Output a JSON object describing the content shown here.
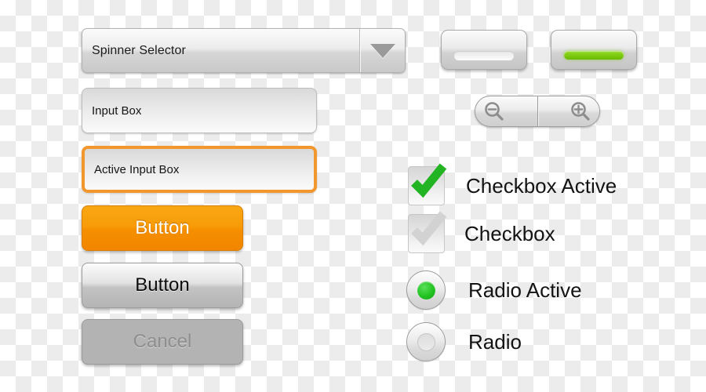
{
  "theme": {
    "accent_orange": "#f58f00",
    "accent_green": "#7ecc12",
    "radio_green": "#22c322",
    "check_green": "#22b422",
    "focus_border": "#f2972e",
    "text_dark": "#131313",
    "text_disabled": "#8e8e8e",
    "canvas_checker_light": "#ffffff",
    "canvas_checker_dark": "#ececec"
  },
  "spinner": {
    "label": "Spinner Selector",
    "arrow_icon": "chevron-down-icon"
  },
  "inputs": [
    {
      "value": "Input Box",
      "state": "normal"
    },
    {
      "value": "Active Input Box",
      "state": "active"
    }
  ],
  "buttons": [
    {
      "label": "Button",
      "style": "primary-orange"
    },
    {
      "label": "Button",
      "style": "default-grey"
    },
    {
      "label": "Cancel",
      "style": "disabled"
    }
  ],
  "toggles": [
    {
      "state": "off",
      "bar_color": "#f2f2f2"
    },
    {
      "state": "on",
      "bar_color": "#7ecc12"
    }
  ],
  "zoom_control": {
    "zoom_out_icon": "magnifier-minus-icon",
    "zoom_in_icon": "magnifier-plus-icon"
  },
  "checkboxes": [
    {
      "label": "Checkbox Active",
      "checked": true,
      "check_icon": "checkmark-icon",
      "check_color": "#22b422"
    },
    {
      "label": "Checkbox",
      "checked": false,
      "check_icon": "checkmark-icon",
      "check_color": "#cfcfcf"
    }
  ],
  "radios": [
    {
      "label": "Radio Active",
      "selected": true,
      "dot_color": "#22c322"
    },
    {
      "label": "Radio",
      "selected": false,
      "dot_color": "#e2e2e2"
    }
  ]
}
